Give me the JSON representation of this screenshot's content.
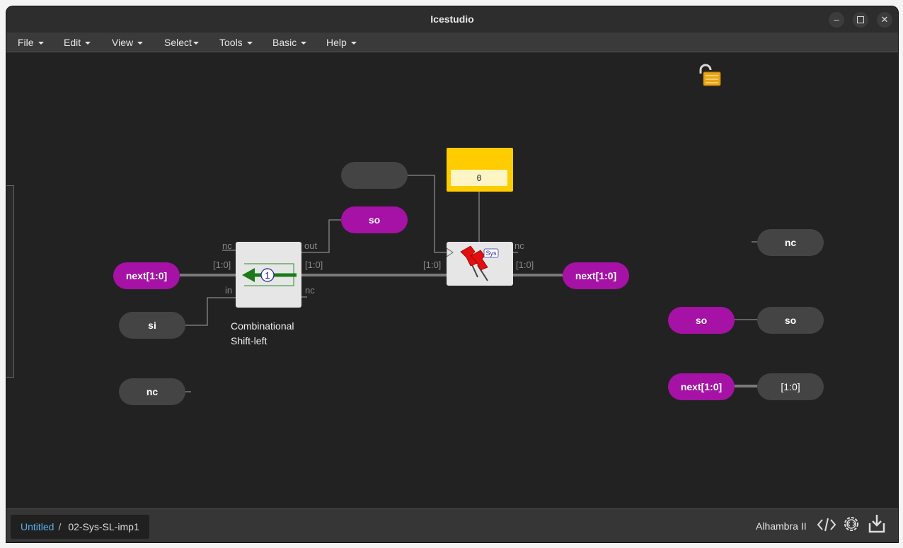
{
  "window": {
    "title": "Icestudio"
  },
  "menus": [
    "File",
    "Edit",
    "View",
    "Select",
    "Tools",
    "Basic",
    "Help"
  ],
  "canvas": {
    "left_inputs": [
      {
        "label": "next[1:0]",
        "color": "purple"
      },
      {
        "label": "si",
        "color": "gray"
      },
      {
        "label": "nc",
        "color": "gray"
      }
    ],
    "shift_block": {
      "ports": {
        "nc_in": "nc",
        "bus_in": "[1:0]",
        "in": "in",
        "out": "out",
        "bus_out": "[1:0]",
        "nc_out": "nc"
      },
      "shift_amount": "1",
      "caption_line1": "Combinational",
      "caption_line2": "Shift-left"
    },
    "so_label": "so",
    "unnamed_input": "",
    "constant_value": "0",
    "reg_block": {
      "ports": {
        "bus_in": "[1:0]",
        "nc_out": "nc",
        "bus_out": "[1:0]"
      },
      "badge": "Sys"
    },
    "output_next": "next[1:0]",
    "right_nc": "nc",
    "right_so_out": "so",
    "right_so_in": "so",
    "right_next": "next[1:0]",
    "right_bus": "[1:0]"
  },
  "status": {
    "breadcrumb_link": "Untitled",
    "breadcrumb_sep": "/",
    "breadcrumb_current": "02-Sys-SL-imp1",
    "board": "Alhambra II"
  },
  "colors": {
    "purple_label": "#a512a5",
    "gray_label": "#444444",
    "constant_yellow": "#ffcc00",
    "shift_arrow": "#1f8a1f"
  },
  "icons": [
    "unlock-icon",
    "code-icon",
    "gear-code-icon",
    "download-icon"
  ]
}
